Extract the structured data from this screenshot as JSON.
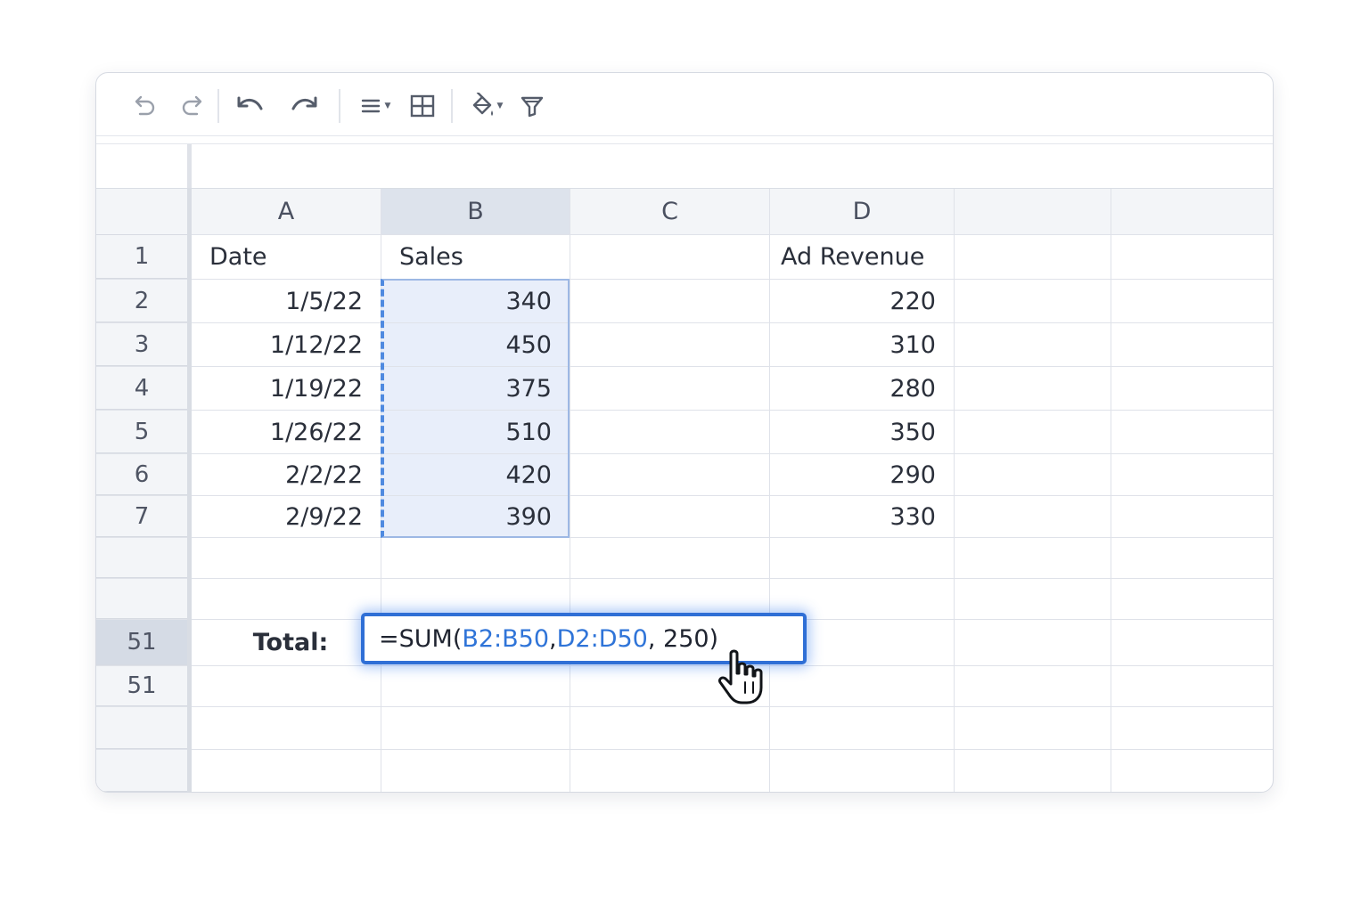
{
  "toolbar": {
    "icons": [
      "undo-small-icon",
      "redo-small-icon",
      "undo-icon",
      "redo-icon",
      "align-icon",
      "borders-icon",
      "fill-color-icon",
      "filter-icon"
    ]
  },
  "columns": [
    "A",
    "B",
    "C",
    "D",
    "",
    ""
  ],
  "rows": [
    {
      "num": "1",
      "a": "Date",
      "b": "Sales",
      "c": "",
      "d": "Ad Revenue"
    },
    {
      "num": "2",
      "a": "1/5/22",
      "b": "340",
      "c": "",
      "d": "220"
    },
    {
      "num": "3",
      "a": "1/12/22",
      "b": "450",
      "c": "",
      "d": "310"
    },
    {
      "num": "4",
      "a": "1/19/22",
      "b": "375",
      "c": "",
      "d": "280"
    },
    {
      "num": "5",
      "a": "1/26/22",
      "b": "510",
      "c": "",
      "d": "350"
    },
    {
      "num": "6",
      "a": "2/2/22",
      "b": "420",
      "c": "",
      "d": "290"
    },
    {
      "num": "7",
      "a": "2/9/22",
      "b": "390",
      "c": "",
      "d": "330"
    }
  ],
  "total_row": {
    "num": "51",
    "label": "Total:"
  },
  "extra_row": {
    "num": "51"
  },
  "formula": {
    "prefix": "=SUM(",
    "ref1": "B2:B50",
    "sep1": ", ",
    "ref2": "D2:D50",
    "suffix": ", 250)"
  },
  "colors": {
    "accent": "#2f6fd6",
    "reference": "#2f74d8",
    "selection": "#e8eefa"
  }
}
